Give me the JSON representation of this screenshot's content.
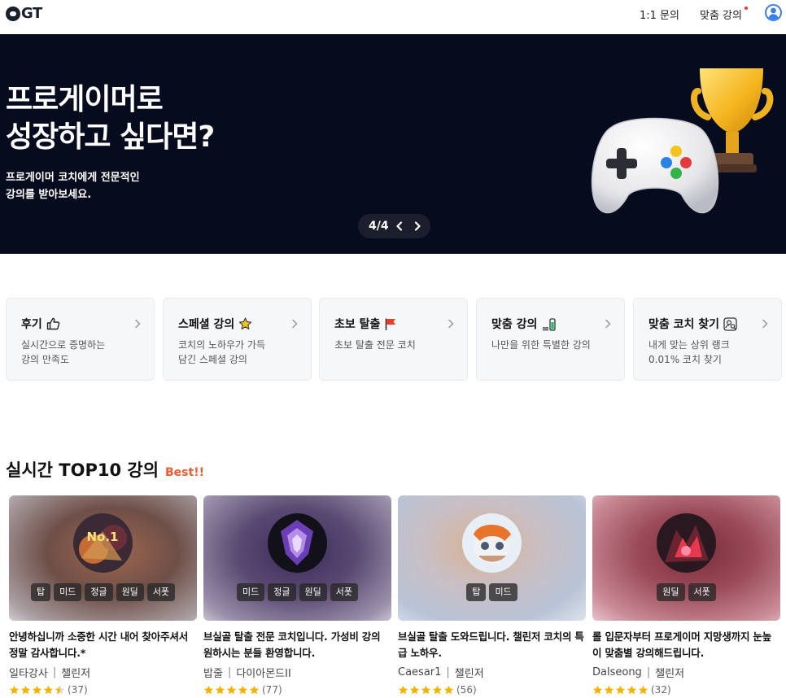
{
  "header": {
    "logo_text": "GT",
    "nav_inquiry": "1:1 문의",
    "nav_custom": "맞춤 강의"
  },
  "hero": {
    "title_line1": "프로게이머로",
    "title_line2": "성장하고 싶다면?",
    "sub_line1": "프로게이머 코치에게 전문적인",
    "sub_line2": "강의를 받아보세요.",
    "pager": "4/4"
  },
  "categories": [
    {
      "title": "후기",
      "icon": "thumbs-up-icon",
      "desc1": "실시간으로 증명하는",
      "desc2": "강의 만족도"
    },
    {
      "title": "스페셜 강의",
      "icon": "star-icon",
      "desc1": "코치의 노하우가 가득",
      "desc2": "담긴 스페셜 강의"
    },
    {
      "title": "초보 탈출",
      "icon": "flag-icon",
      "desc1": "초보 탈출 전문 코치",
      "desc2": ""
    },
    {
      "title": "맞춤 강의",
      "icon": "battery-icon",
      "desc1": "나만을 위한 특별한 강의",
      "desc2": ""
    },
    {
      "title": "맞춤 코치 찾기",
      "icon": "person-search-icon",
      "desc1": "내게 맞는 상위 랭크",
      "desc2": "0.01% 코치 찾기"
    }
  ],
  "section": {
    "title": "실시간 TOP10 강의",
    "badge": "Best!!"
  },
  "courses": [
    {
      "tags": [
        "탑",
        "미드",
        "정글",
        "원딜",
        "서폿"
      ],
      "title": "안녕하십니까 소중한 시간 내어 찾아주셔서 정말 감사합니다.*",
      "author": "일타강사",
      "rank": "챌린저",
      "rating": 4.5,
      "count": "(37)"
    },
    {
      "tags": [
        "미드",
        "정글",
        "원딜",
        "서폿"
      ],
      "title": "브실골 탈출 전문 코치입니다. 가성비 강의 원하시는 분들 환영합니다.",
      "author": "밥줄",
      "rank": "다이아몬드II",
      "rating": 5,
      "count": "(77)"
    },
    {
      "tags": [
        "탑",
        "미드"
      ],
      "title": "브실골 탈출 도와드립니다. 챌린저 코치의 특급 노하우.",
      "author": "Caesar1",
      "rank": "챌린저",
      "rating": 5,
      "count": "(56)"
    },
    {
      "tags": [
        "원딜",
        "서폿"
      ],
      "title": "롤 입문자부터 프로게이머 지망생까지 눈높이 맞춤별 강의해드립니다.",
      "author": "Dalseong",
      "rank": "챌린저",
      "rating": 5,
      "count": "(32)"
    }
  ],
  "colors": {
    "hero_bg": "#070b1e",
    "accent_best": "#ef5b2e",
    "star": "#f5b300",
    "user_icon": "#3b7dea"
  }
}
